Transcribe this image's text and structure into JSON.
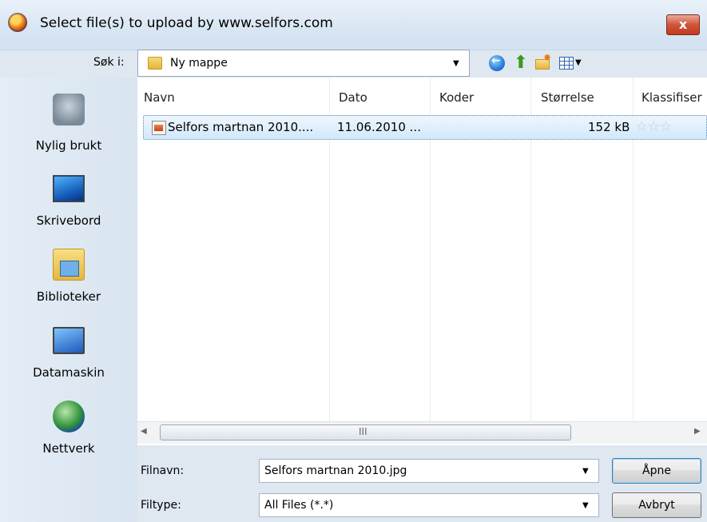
{
  "window": {
    "title": "Select file(s) to upload by www.selfors.com",
    "close_label": "x"
  },
  "lookin": {
    "label": "Søk i:",
    "value": "Ny mappe"
  },
  "places": [
    {
      "label": "Nylig brukt"
    },
    {
      "label": "Skrivebord"
    },
    {
      "label": "Biblioteker"
    },
    {
      "label": "Datamaskin"
    },
    {
      "label": "Nettverk"
    }
  ],
  "columns": {
    "name": "Navn",
    "date": "Dato",
    "tags": "Koder",
    "size": "Størrelse",
    "rating": "Klassifiser"
  },
  "files": [
    {
      "name": "Selfors martnan 2010....",
      "date": "11.06.2010 ...",
      "size": "152 kB",
      "rating": "☆☆☆"
    }
  ],
  "scrollbar": {
    "grip": "III"
  },
  "filename": {
    "label": "Filnavn:",
    "value": "Selfors martnan 2010.jpg"
  },
  "filetype": {
    "label": "Filtype:",
    "value": "All Files (*.*)"
  },
  "buttons": {
    "open": "Åpne",
    "cancel": "Avbryt"
  },
  "colors": {
    "selection": "#d2e8fb",
    "title_bar": "#d9e6f3",
    "close_button": "#d0553a"
  }
}
